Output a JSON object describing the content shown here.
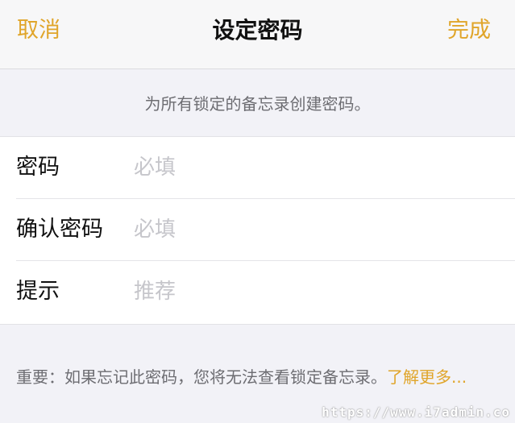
{
  "nav": {
    "cancel_label": "取消",
    "title": "设定密码",
    "done_label": "完成"
  },
  "description": "为所有锁定的备忘录创建密码。",
  "form": {
    "rows": [
      {
        "label": "密码",
        "placeholder": "必填",
        "value": ""
      },
      {
        "label": "确认密码",
        "placeholder": "必填",
        "value": ""
      },
      {
        "label": "提示",
        "placeholder": "推荐",
        "value": ""
      }
    ]
  },
  "footer": {
    "text": "重要：如果忘记此密码，您将无法查看锁定备忘录。",
    "link": "了解更多..."
  },
  "watermark": "https://www.i7admin.co",
  "colors": {
    "accent": "#e0a52a",
    "background": "#f2f2f7",
    "secondary_text": "#6d6d72",
    "placeholder": "#c6c6cb"
  }
}
